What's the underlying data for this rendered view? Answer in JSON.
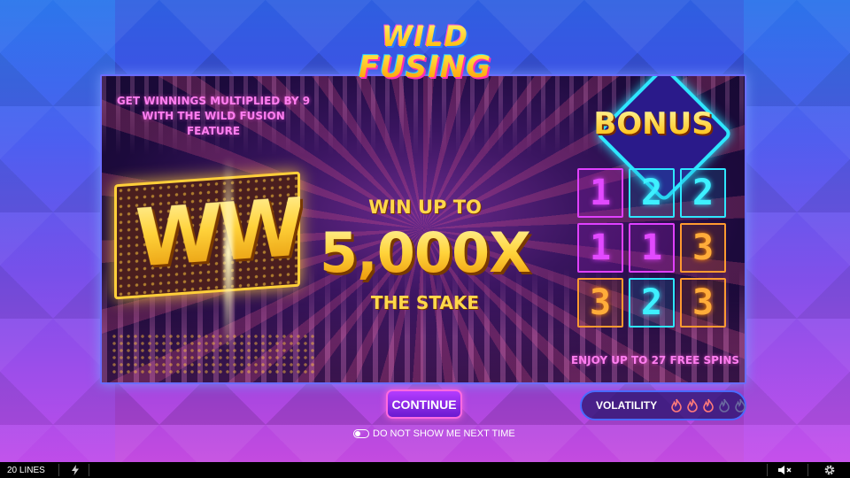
{
  "logo": {
    "line1": "WILD",
    "line2": "FUSING"
  },
  "panel": {
    "promo_text": "GET WINNINGS MULTIPLIED BY 9 WITH THE WILD FUSION FEATURE",
    "ww_symbol": "WW",
    "win_upto": "WIN UP TO",
    "win_amount": "5,000X",
    "win_stake": "THE STAKE",
    "bonus_label": "BONUS",
    "bonus_grid": [
      {
        "value": "1",
        "color": "magenta"
      },
      {
        "value": "2",
        "color": "cyan"
      },
      {
        "value": "2",
        "color": "cyan"
      },
      {
        "value": "1",
        "color": "magenta"
      },
      {
        "value": "1",
        "color": "magenta"
      },
      {
        "value": "3",
        "color": "orange"
      },
      {
        "value": "3",
        "color": "orange"
      },
      {
        "value": "2",
        "color": "cyan"
      },
      {
        "value": "3",
        "color": "orange"
      }
    ],
    "free_spins": "ENJOY UP TO 27 FREE SPINS"
  },
  "controls": {
    "continue_label": "CONTINUE",
    "dont_show_label": "DO NOT SHOW ME NEXT TIME",
    "dont_show_checked": false
  },
  "volatility": {
    "label": "VOLATILITY",
    "level": 3,
    "max": 5,
    "active_color": "#ff7a7a",
    "inactive_color": "#6a6aa0"
  },
  "bottom_bar": {
    "lines_label": "20 LINES",
    "icons": [
      "lightning-icon",
      "sound-muted-icon",
      "gear-icon"
    ]
  },
  "colors": {
    "accent_gold": "#ffd33a",
    "accent_pink": "#ff7ef0",
    "accent_cyan": "#2ee6ff",
    "button_purple": "#9a30f0"
  }
}
